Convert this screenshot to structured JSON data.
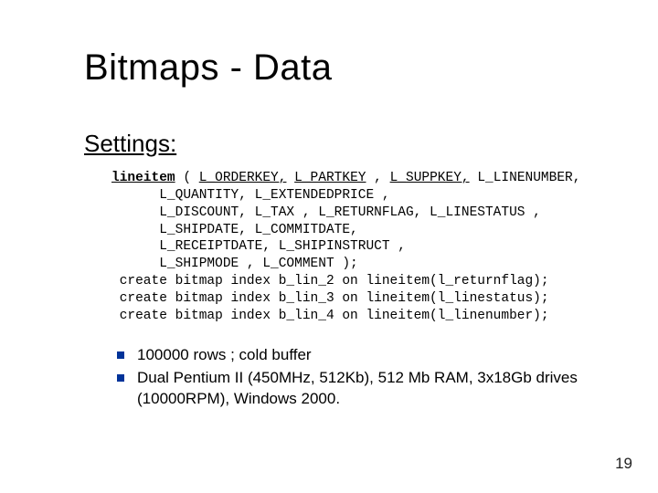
{
  "title": "Bitmaps - Data",
  "subtitle": "Settings:",
  "code": {
    "line1_pre": "lineitem",
    "line1_mid": " ( ",
    "line1_u1": "L_ORDERKEY,",
    "line1_sp1": " ",
    "line1_u2": "L_PARTKEY",
    "line1_sp2": " , ",
    "line1_u3": "L_SUPPKEY,",
    "line1_sp3": " ",
    "line1_rest": "L_LINENUMBER,",
    "line2": "      L_QUANTITY, L_EXTENDEDPRICE ,",
    "line3": "      L_DISCOUNT, L_TAX , L_RETURNFLAG, L_LINESTATUS ,",
    "line4": "      L_SHIPDATE, L_COMMITDATE,",
    "line5": "      L_RECEIPTDATE, L_SHIPINSTRUCT ,",
    "line6": "      L_SHIPMODE , L_COMMENT );",
    "line7": " create bitmap index b_lin_2 on lineitem(l_returnflag);",
    "line8": " create bitmap index b_lin_3 on lineitem(l_linestatus);",
    "line9": " create bitmap index b_lin_4 on lineitem(l_linenumber);"
  },
  "notes": [
    "100000 rows ; cold buffer",
    "Dual Pentium II (450MHz, 512Kb), 512 Mb RAM, 3x18Gb drives (10000RPM), Windows 2000."
  ],
  "pageNumber": "19"
}
